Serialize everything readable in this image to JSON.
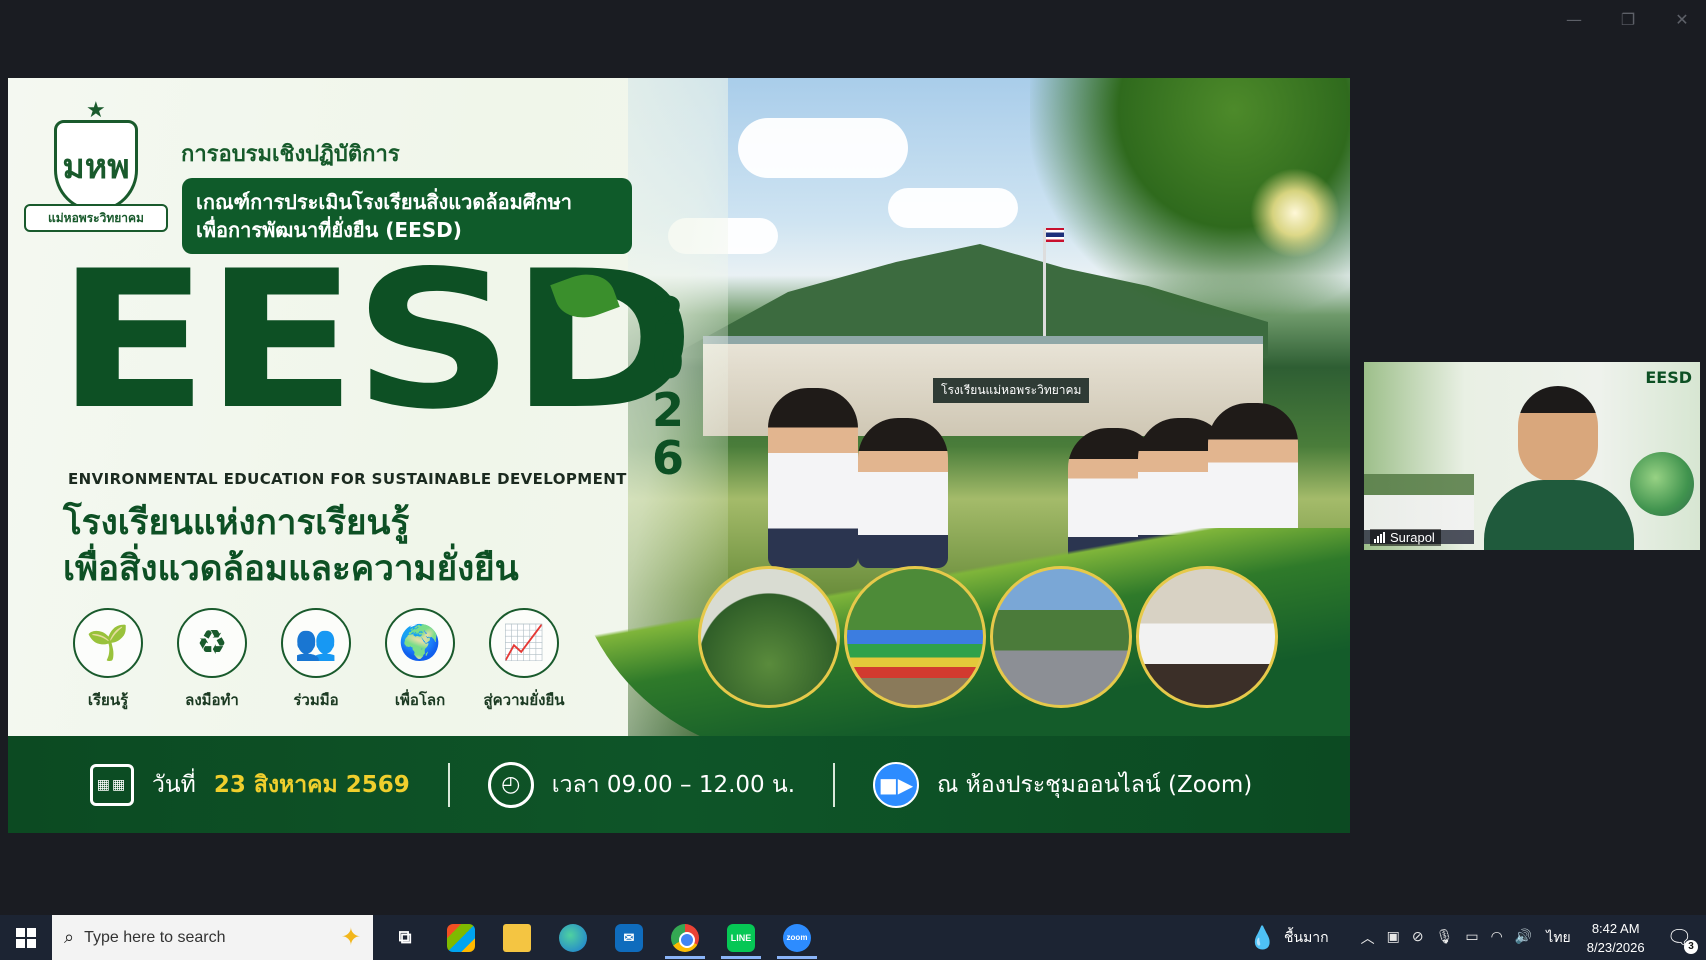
{
  "window": {
    "controls": [
      "minimize-icon",
      "restore-icon",
      "close-icon"
    ]
  },
  "slide": {
    "logo_text": "แม่หอพระวิทยาคม",
    "logo_initials": "มหพ",
    "workshop": "การอบรมเชิงปฏิบัติการ",
    "topic_line1": "เกณฑ์การประเมินโรงเรียนสิ่งแวดล้อมศึกษา",
    "topic_line2": "เพื่อการพัฒนาที่ยั่งยืน (EESD)",
    "brand": "EESD",
    "year_digits": [
      "2",
      "0",
      "2",
      "6"
    ],
    "subtitle_en": "ENVIRONMENTAL EDUCATION FOR SUSTAINABLE DEVELOPMENT",
    "thai_line1": "โรงเรียนแห่งการเรียนรู้",
    "thai_line2": "เพื่อสิ่งแวดล้อมและความยั่งยืน",
    "school_sign": "โรงเรียนแม่หอพระวิทยาคม",
    "pillars": [
      {
        "icon": "sprout-icon",
        "glyph": "🌱",
        "label": "เรียนรู้"
      },
      {
        "icon": "recycle-icon",
        "glyph": "♻",
        "label": "ลงมือทำ"
      },
      {
        "icon": "people-icon",
        "glyph": "👥",
        "label": "ร่วมมือ"
      },
      {
        "icon": "globe-icon",
        "glyph": "🌍",
        "label": "เพื่อโลก"
      },
      {
        "icon": "growth-chart-icon",
        "glyph": "📈",
        "label": "สู่ความยั่งยืน"
      }
    ],
    "info": {
      "date_prefix": "วันที่",
      "date_value": "23 สิงหาคม 2569",
      "time": "เวลา 09.00 – 12.00 น.",
      "venue": "ณ ห้องประชุมออนไลน์ (Zoom)"
    },
    "colors": {
      "dark_green": "#0d5024",
      "highlight": "#f0cf2d",
      "zoom_blue": "#2d8cff"
    }
  },
  "participant": {
    "name": "Surapol",
    "background_brand": "EESD"
  },
  "taskbar": {
    "search_placeholder": "Type here to search",
    "apps": [
      "task-view-icon",
      "microsoft-store-icon",
      "file-explorer-icon",
      "edge-icon",
      "outlook-icon",
      "chrome-icon",
      "line-icon",
      "zoom-icon"
    ],
    "line_label": "LINE",
    "zoom_label": "zoom",
    "weather": "ชื้นมาก",
    "language": "ไทย",
    "time": "8:42 AM",
    "date": "8/23/2026",
    "notification_count": "3"
  }
}
